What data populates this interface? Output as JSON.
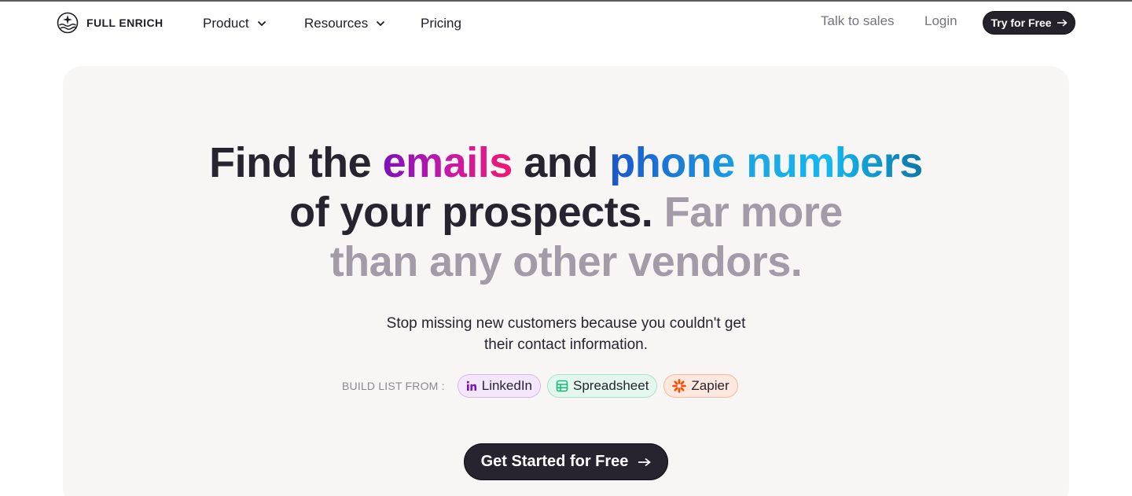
{
  "brand": {
    "name": "FULL ENRICH"
  },
  "nav": {
    "product": "Product",
    "resources": "Resources",
    "pricing": "Pricing",
    "talk_to_sales": "Talk to sales",
    "login": "Login",
    "try_free": "Try for Free"
  },
  "hero": {
    "headline_part1": "Find the ",
    "headline_emails": "emails",
    "headline_and": " and ",
    "headline_phone": "phone numbers",
    "headline_part2": "of your prospects. ",
    "headline_muted1": "Far more",
    "headline_muted2": "than any other vendors.",
    "subtitle_line1": "Stop missing new customers because you couldn't get",
    "subtitle_line2": "their contact information.",
    "build_list_label": "BUILD LIST FROM :",
    "sources": [
      "LinkedIn",
      "Spreadsheet",
      "Zapier"
    ],
    "cta": "Get Started for Free"
  },
  "colors": {
    "primary_dark": "#27232f",
    "muted_text": "#a19ca7",
    "hero_bg": "#f8f6f5",
    "emails_gradient": [
      "#7d10b8",
      "#f2176f"
    ],
    "phone_gradient": [
      "#1b56c9",
      "#0f77a8"
    ]
  },
  "icons": [
    "logo-compass-wave-icon",
    "chevron-down-icon",
    "arrow-right-icon",
    "linkedin-icon",
    "spreadsheet-icon",
    "zapier-icon"
  ]
}
